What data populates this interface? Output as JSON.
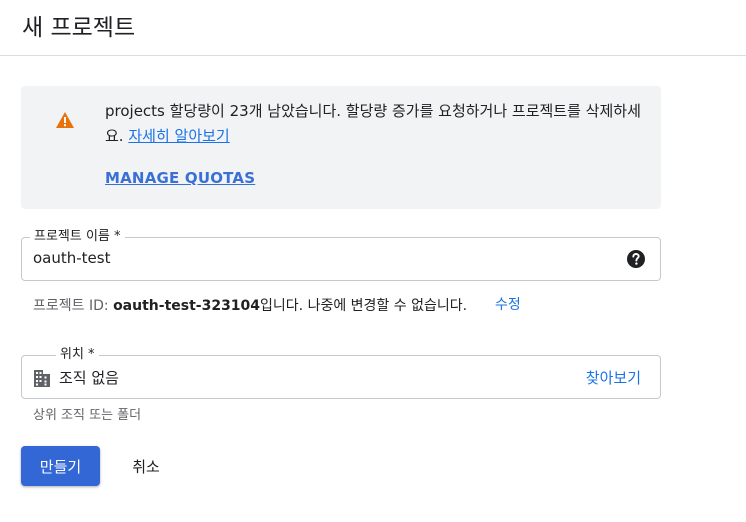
{
  "header": {
    "title": "새 프로젝트"
  },
  "banner": {
    "message": "projects 할당량이 23개 남았습니다. 할당량 증가를 요청하거나 프로젝트를 삭제하세요.",
    "learn_more": "자세히 알아보기",
    "manage_quotas": "MANAGE QUOTAS",
    "icon": "warning-icon",
    "icon_color": "#e8710a"
  },
  "project_name": {
    "label": "프로젝트 이름 *",
    "value": "oauth-test",
    "help_icon": "help-circle-icon"
  },
  "project_id": {
    "prefix": "프로젝트 ID:",
    "id": "oauth-test-323104",
    "suffix": "입니다. 나중에 변경할 수 없습니다.",
    "edit": "수정"
  },
  "location": {
    "label": "위치 *",
    "value": "조직 없음",
    "browse": "찾아보기",
    "helper": "상위 조직 또는 폴더",
    "icon": "building-icon"
  },
  "actions": {
    "create": "만들기",
    "cancel": "취소"
  },
  "colors": {
    "accent": "#1a73e8",
    "primary_button": "#3367d6"
  }
}
